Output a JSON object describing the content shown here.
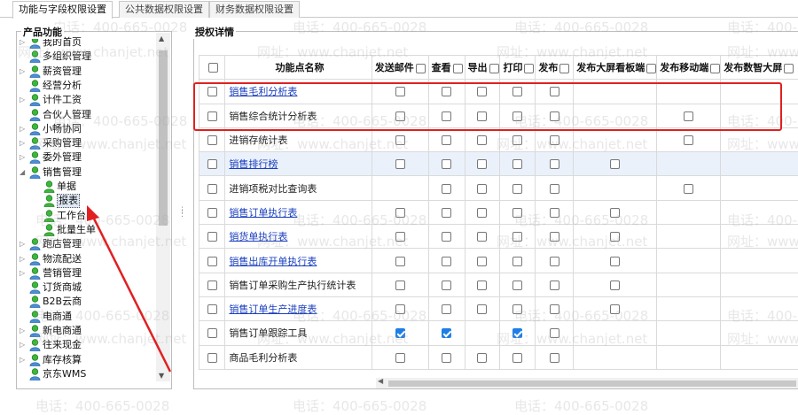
{
  "tabs": [
    {
      "label": "功能与字段权限设置",
      "active": true
    },
    {
      "label": "公共数据权限设置",
      "active": false
    },
    {
      "label": "财务数据权限设置",
      "active": false
    }
  ],
  "left_panel": {
    "title": "产品功能",
    "tree": [
      {
        "label": "我的首页",
        "level": 0,
        "expander": "collapsed"
      },
      {
        "label": "多组织管理",
        "level": 0,
        "expander": "none"
      },
      {
        "label": "薪资管理",
        "level": 0,
        "expander": "collapsed"
      },
      {
        "label": "经营分析",
        "level": 0,
        "expander": "none"
      },
      {
        "label": "计件工资",
        "level": 0,
        "expander": "collapsed"
      },
      {
        "label": "合伙人管理",
        "level": 0,
        "expander": "none"
      },
      {
        "label": "小畅协同",
        "level": 0,
        "expander": "collapsed"
      },
      {
        "label": "采购管理",
        "level": 0,
        "expander": "collapsed"
      },
      {
        "label": "委外管理",
        "level": 0,
        "expander": "collapsed"
      },
      {
        "label": "销售管理",
        "level": 0,
        "expander": "expanded"
      },
      {
        "label": "单据",
        "level": 1,
        "expander": "none"
      },
      {
        "label": "报表",
        "level": 1,
        "expander": "none",
        "selected": true
      },
      {
        "label": "工作台",
        "level": 1,
        "expander": "none"
      },
      {
        "label": "批量生单",
        "level": 1,
        "expander": "none"
      },
      {
        "label": "跑店管理",
        "level": 0,
        "expander": "collapsed"
      },
      {
        "label": "物流配送",
        "level": 0,
        "expander": "collapsed"
      },
      {
        "label": "营销管理",
        "level": 0,
        "expander": "collapsed"
      },
      {
        "label": "订货商城",
        "level": 0,
        "expander": "none"
      },
      {
        "label": "B2B云商",
        "level": 0,
        "expander": "none"
      },
      {
        "label": "电商通",
        "level": 0,
        "expander": "none"
      },
      {
        "label": "新电商通",
        "level": 0,
        "expander": "collapsed"
      },
      {
        "label": "往来现金",
        "level": 0,
        "expander": "collapsed"
      },
      {
        "label": "库存核算",
        "level": 0,
        "expander": "collapsed"
      },
      {
        "label": "京东WMS",
        "level": 0,
        "expander": "none"
      }
    ]
  },
  "right_panel": {
    "title": "授权详情",
    "columns": [
      {
        "label": "",
        "has_checkbox": true
      },
      {
        "label": "功能点名称",
        "has_checkbox": false
      },
      {
        "label": "发送邮件",
        "has_checkbox": true
      },
      {
        "label": "查看",
        "has_checkbox": true
      },
      {
        "label": "导出",
        "has_checkbox": true
      },
      {
        "label": "打印",
        "has_checkbox": true
      },
      {
        "label": "发布",
        "has_checkbox": true
      },
      {
        "label": "发布大屏看板端",
        "has_checkbox": true
      },
      {
        "label": "发布移动端",
        "has_checkbox": true
      },
      {
        "label": "发布数智大屏",
        "has_checkbox": true
      }
    ],
    "rows": [
      {
        "name": "销售毛利分析表",
        "link": true,
        "highlight": false,
        "cells": [
          "empty",
          "empty",
          "empty",
          "empty",
          "empty",
          "none",
          "none",
          "none"
        ]
      },
      {
        "name": "销售综合统计分析表",
        "link": false,
        "highlight": false,
        "cells": [
          "empty",
          "empty",
          "empty",
          "empty",
          "empty",
          "none",
          "empty",
          "none"
        ]
      },
      {
        "name": "进销存统计表",
        "link": false,
        "highlight": false,
        "cells": [
          "empty",
          "empty",
          "empty",
          "empty",
          "empty",
          "none",
          "empty",
          "none"
        ]
      },
      {
        "name": "销售排行榜",
        "link": true,
        "highlight": true,
        "cells": [
          "empty",
          "empty",
          "empty",
          "empty",
          "empty",
          "empty",
          "none",
          "none"
        ]
      },
      {
        "name": "进销项税对比查询表",
        "link": false,
        "highlight": false,
        "cells": [
          "none",
          "empty",
          "empty",
          "empty",
          "empty",
          "none",
          "empty",
          "none"
        ]
      },
      {
        "name": "销售订单执行表",
        "link": true,
        "highlight": false,
        "cells": [
          "empty",
          "empty",
          "empty",
          "empty",
          "empty",
          "empty",
          "none",
          "none"
        ]
      },
      {
        "name": "销货单执行表",
        "link": true,
        "highlight": false,
        "cells": [
          "empty",
          "empty",
          "empty",
          "empty",
          "empty",
          "empty",
          "none",
          "none"
        ]
      },
      {
        "name": "销售出库开单执行表",
        "link": true,
        "highlight": false,
        "cells": [
          "empty",
          "empty",
          "empty",
          "empty",
          "empty",
          "empty",
          "none",
          "none"
        ]
      },
      {
        "name": "销售订单采购生产执行统计表",
        "link": false,
        "highlight": false,
        "cells": [
          "empty",
          "empty",
          "empty",
          "empty",
          "empty",
          "empty",
          "none",
          "none"
        ]
      },
      {
        "name": "销售订单生产进度表",
        "link": true,
        "highlight": false,
        "cells": [
          "empty",
          "empty",
          "empty",
          "empty",
          "empty",
          "empty",
          "none",
          "none"
        ]
      },
      {
        "name": "销售订单跟踪工具",
        "link": false,
        "highlight": false,
        "cells": [
          "checked",
          "checked",
          "none",
          "checked",
          "empty",
          "none",
          "none",
          "none"
        ]
      },
      {
        "name": "商品毛利分析表",
        "link": false,
        "highlight": false,
        "cells": [
          "empty",
          "empty",
          "empty",
          "empty",
          "empty",
          "none",
          "none",
          "none"
        ]
      }
    ]
  },
  "watermark": {
    "phone": "电话：400-665-0028",
    "site": "网址：www.chanjet.net"
  },
  "colors": {
    "annotation_red": "#e02020",
    "link_blue": "#1a3fbf",
    "checkbox_blue": "#1e7ee6",
    "row_highlight": "#eaf1fb"
  }
}
